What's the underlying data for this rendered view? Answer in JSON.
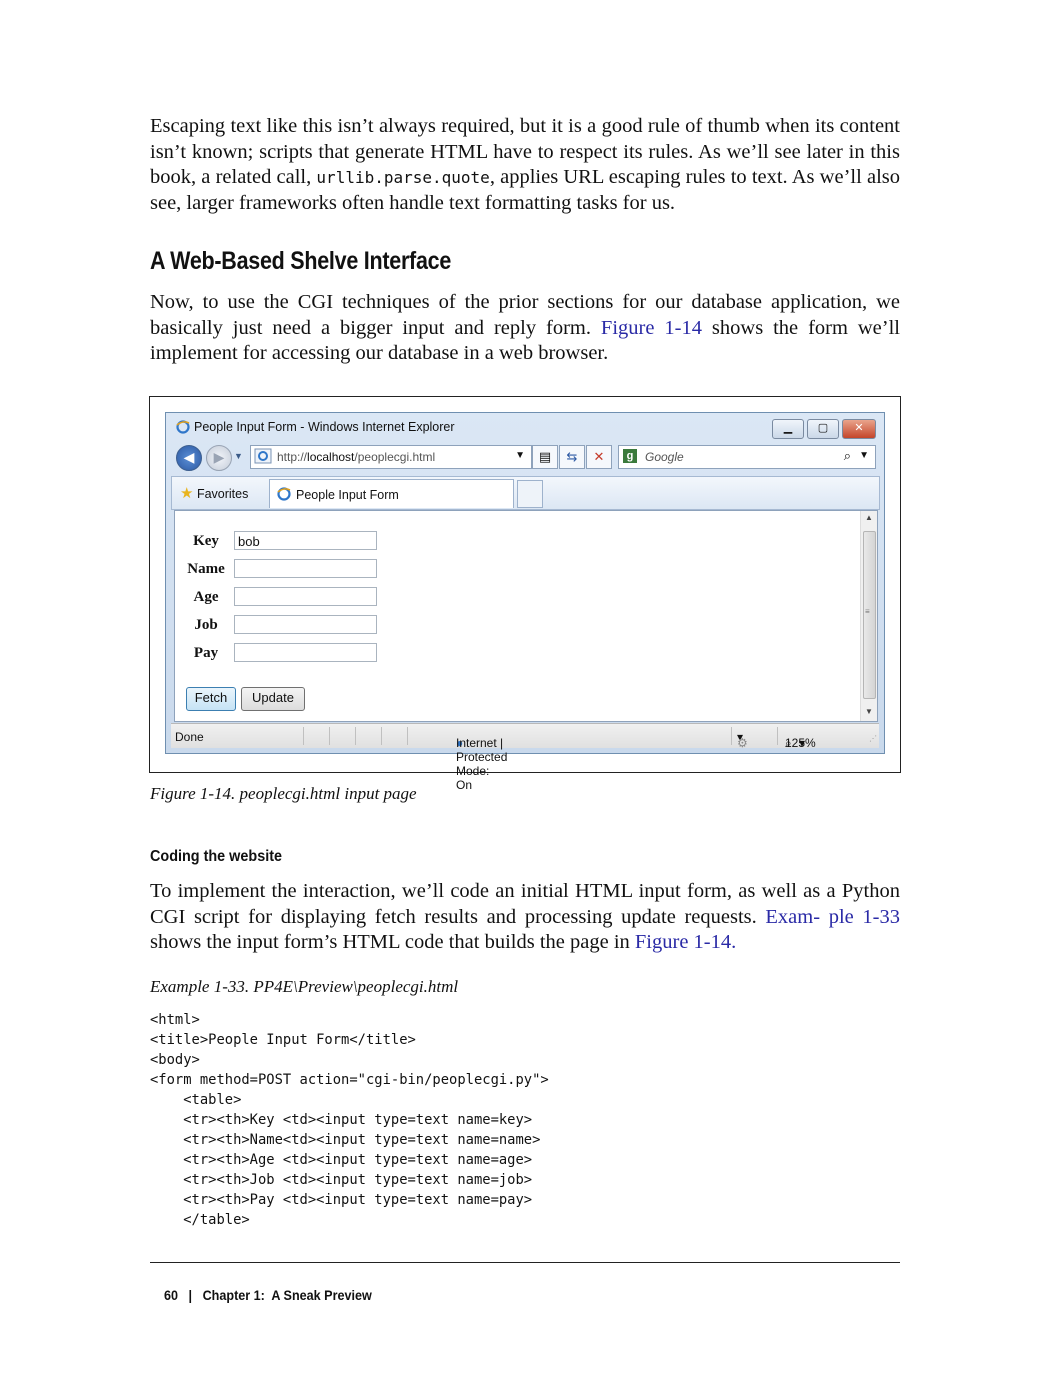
{
  "intro": {
    "text_before_code": "Escaping text like this isn’t always required, but it is a good rule of thumb when its content isn’t known; scripts that generate HTML have to respect its rules. As we’ll see later in this book, a related call, ",
    "code_term": "urllib.parse.quote",
    "text_after_code": ", applies URL escaping rules to text. As we’ll also see, larger frameworks often handle text formatting tasks for us."
  },
  "section_heading": "A Web-Based Shelve Interface",
  "section_para": {
    "before": "Now, to use the CGI techniques of the prior sections for our database application, we basically just need a bigger input and reply form. ",
    "figure_ref": "Figure 1-14",
    "after": " shows the form we’ll implement for accessing our database in a web browser."
  },
  "browser": {
    "window_title": "People Input Form - Windows Internet Explorer",
    "url_prefix": "http://",
    "url_host": "localhost",
    "url_path": "/peoplecgi.html",
    "search_placeholder": "Google",
    "favorites_label": "Favorites",
    "tab_label": "People Input Form",
    "form": {
      "fields": [
        {
          "label": "Key",
          "value": "bob"
        },
        {
          "label": "Name",
          "value": ""
        },
        {
          "label": "Age",
          "value": ""
        },
        {
          "label": "Job",
          "value": ""
        },
        {
          "label": "Pay",
          "value": ""
        }
      ],
      "fetch_label": "Fetch",
      "update_label": "Update"
    },
    "status": {
      "left": "Done",
      "zone": "Internet | Protected Mode: On",
      "zoom": "125%"
    }
  },
  "figure_caption": "Figure 1-14. peoplecgi.html input page",
  "subheading": "Coding the website",
  "website_para": {
    "before": "To implement the interaction, we’ll code an initial HTML input form, as well as a Python CGI script for displaying fetch results and processing update requests. ",
    "example_ref_a": "Exam-",
    "example_ref_b": "ple 1-33",
    "middle": " shows the input form’s HTML code that builds the page in ",
    "figure_ref": "Figure 1-14",
    "end": "."
  },
  "example_caption": "Example 1-33. PP4E\\Preview\\peoplecgi.html",
  "code": "<html>\n<title>People Input Form</title>\n<body>\n<form method=POST action=\"cgi-bin/peoplecgi.py\">\n    <table>\n    <tr><th>Key <td><input type=text name=key>\n    <tr><th>Name<td><input type=text name=name>\n    <tr><th>Age <td><input type=text name=age>\n    <tr><th>Job <td><input type=text name=job>\n    <tr><th>Pay <td><input type=text name=pay>\n    </table>",
  "footer": {
    "page_number": "60",
    "separator": "|",
    "chapter": "Chapter 1:  A Sneak Preview"
  }
}
